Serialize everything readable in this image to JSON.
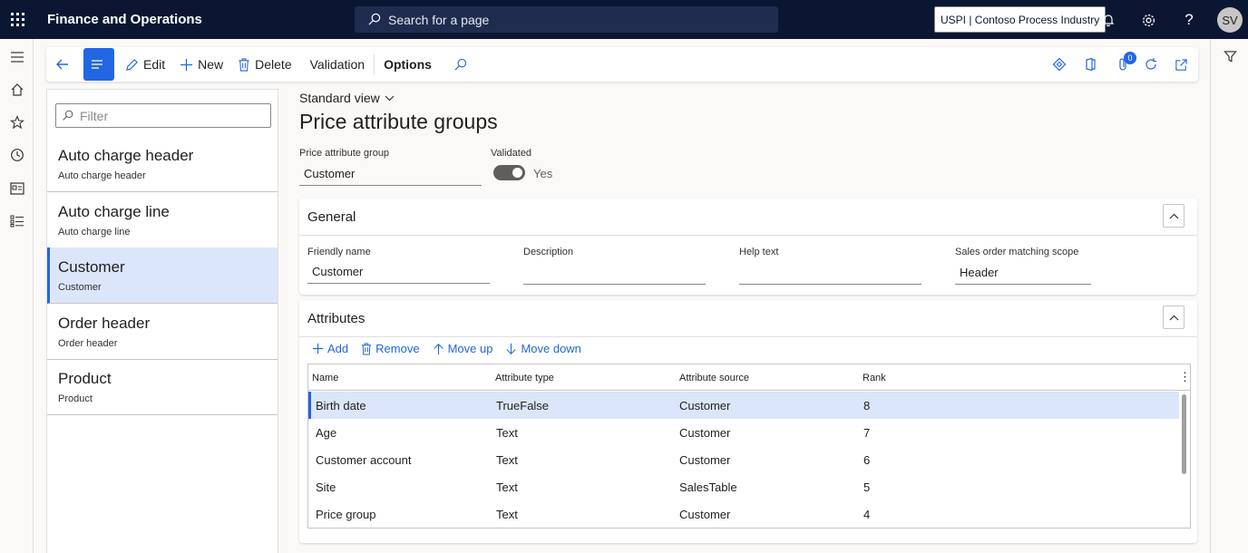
{
  "app": {
    "title": "Finance and Operations",
    "search_placeholder": "Search for a page",
    "company": "USPI | Contoso Process Industry",
    "user_initials": "SV"
  },
  "actionpane": {
    "edit": "Edit",
    "new": "New",
    "delete": "Delete",
    "validation": "Validation",
    "options": "Options",
    "attachments_count": "0"
  },
  "list": {
    "filter_placeholder": "Filter",
    "items": [
      {
        "title": "Auto charge header",
        "subtitle": "Auto charge header"
      },
      {
        "title": "Auto charge line",
        "subtitle": "Auto charge line"
      },
      {
        "title": "Customer",
        "subtitle": "Customer"
      },
      {
        "title": "Order header",
        "subtitle": "Order header"
      },
      {
        "title": "Product",
        "subtitle": "Product"
      }
    ]
  },
  "main": {
    "view": "Standard view",
    "title": "Price attribute groups",
    "group_label": "Price attribute group",
    "group_value": "Customer",
    "validated_label": "Validated",
    "validated_value": "Yes"
  },
  "general": {
    "header": "General",
    "friendly_name_label": "Friendly name",
    "friendly_name_value": "Customer",
    "description_label": "Description",
    "description_value": "",
    "help_text_label": "Help text",
    "help_text_value": "",
    "scope_label": "Sales order matching scope",
    "scope_value": "Header"
  },
  "attributes": {
    "header": "Attributes",
    "toolbar": {
      "add": "Add",
      "remove": "Remove",
      "move_up": "Move up",
      "move_down": "Move down"
    },
    "columns": [
      "Name",
      "Attribute type",
      "Attribute source",
      "Rank"
    ],
    "rows": [
      [
        "Birth date",
        "TrueFalse",
        "Customer",
        "8"
      ],
      [
        "Age",
        "Text",
        "Customer",
        "7"
      ],
      [
        "Customer account",
        "Text",
        "Customer",
        "6"
      ],
      [
        "Site",
        "Text",
        "SalesTable",
        "5"
      ],
      [
        "Price group",
        "Text",
        "Customer",
        "4"
      ]
    ]
  },
  "colors": {
    "topbar": "#0b1633",
    "accent": "#2266e3",
    "selection": "#dce6fb"
  }
}
